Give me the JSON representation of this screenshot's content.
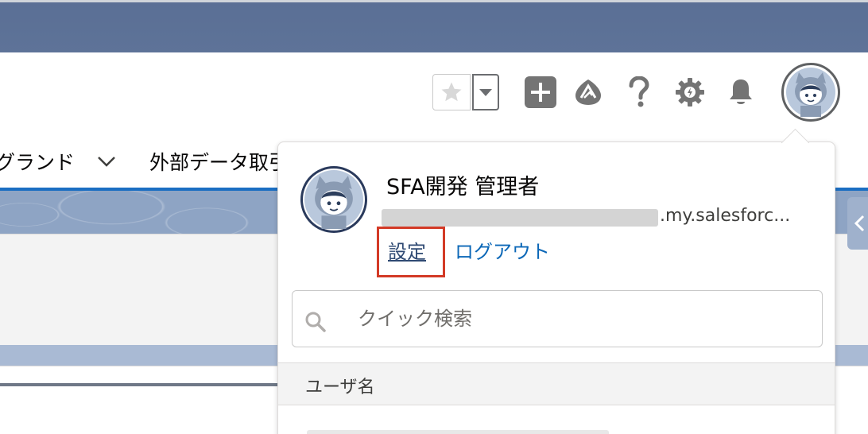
{
  "colors": {
    "header_band": "#5e7398",
    "brand_blue": "#1b6ec2",
    "link_blue": "#0b67b7",
    "highlight_box": "#d33a26",
    "icon_gray": "#747474"
  },
  "global_header": {
    "icons": [
      "favorites-star-icon",
      "favorites-dropdown-icon",
      "global-actions-plus-icon",
      "trailhead-icon",
      "help-icon",
      "setup-gear-icon",
      "notifications-bell-icon",
      "user-avatar-icon"
    ]
  },
  "nav": {
    "items": [
      {
        "label": "グランド"
      },
      {
        "label": "外部データ取引"
      }
    ]
  },
  "user_menu": {
    "name": "SFA開発 管理者",
    "username_visible": ".my.salesforc...",
    "settings_label": "設定",
    "logout_label": "ログアウト",
    "search_placeholder": "クイック検索",
    "section_header": "ユーザ名"
  }
}
